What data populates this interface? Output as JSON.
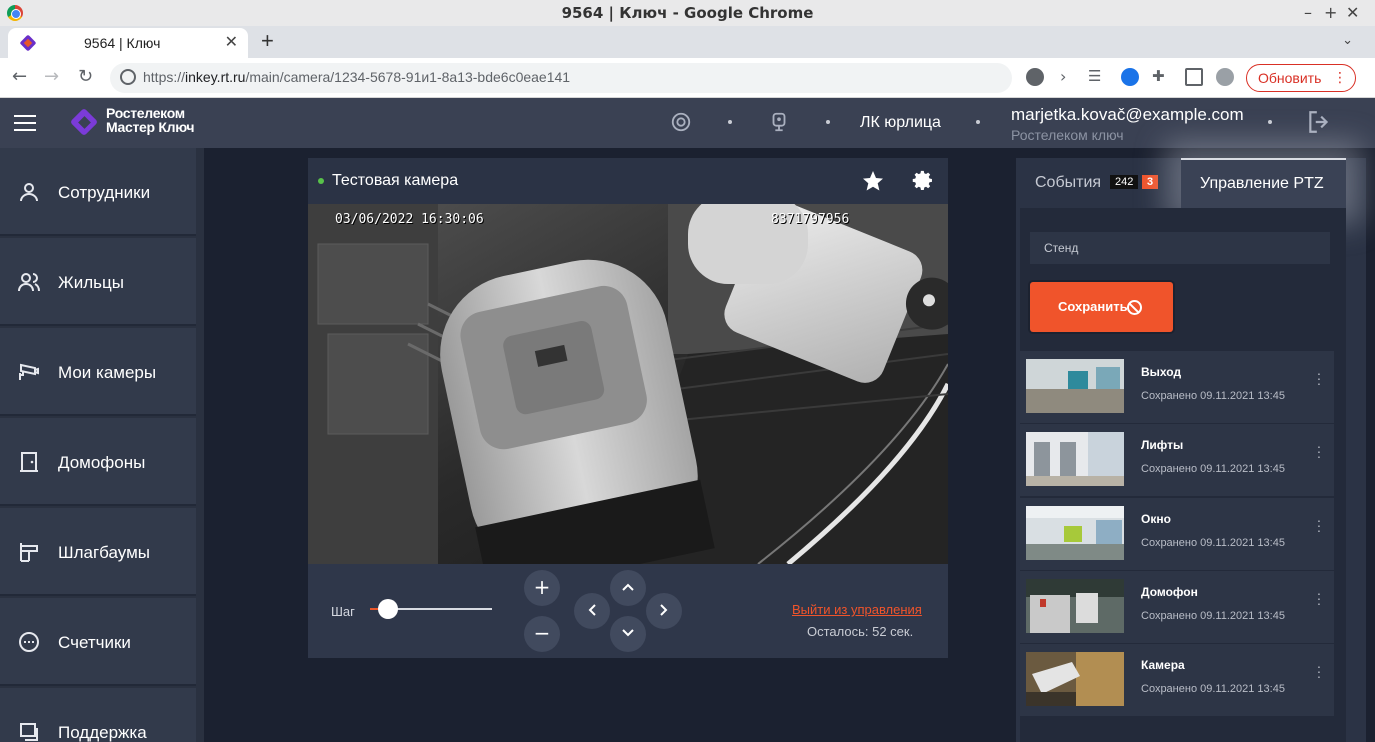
{
  "browser": {
    "window_title": "9564 | Ключ - Google Chrome",
    "tab_title": "9564 | Ключ",
    "url_prefix": "https://",
    "url_host": "inkey.rt.ru",
    "url_path": "/main/camera/1234-5678-91и1-8a13-bde6c0eae141",
    "update_label": "Обновить"
  },
  "header": {
    "logo_line1": "Ростелеком",
    "logo_line2": "Мастер Ключ",
    "account_link": "ЛК юрлица",
    "email": "marjetka.kovač@example.com",
    "company": "Ростелеком ключ"
  },
  "sidebar": {
    "items": [
      {
        "label": "Сотрудники",
        "icon": "person-icon"
      },
      {
        "label": "Жильцы",
        "icon": "people-icon"
      },
      {
        "label": "Мои камеры",
        "icon": "camera-icon"
      },
      {
        "label": "Домофоны",
        "icon": "door-icon"
      },
      {
        "label": "Шлагбаумы",
        "icon": "barrier-icon"
      },
      {
        "label": "Счетчики",
        "icon": "meter-icon"
      },
      {
        "label": "Поддержка",
        "icon": "support-icon"
      }
    ]
  },
  "camera": {
    "title": "Тестовая камера",
    "timestamp": "03/06/2022 16:30:06",
    "serial": "8371797956",
    "step_label": "Шаг",
    "step_value": 0.15,
    "exit_label": "Выйти из управления",
    "remaining": "Осталось: 52 сек."
  },
  "right_panel": {
    "events_label": "События",
    "events_total": "242",
    "events_new": "3",
    "ptz_label": "Управление PTZ",
    "preset_input_value": "Стенд",
    "save_label": "Сохранить",
    "presets": [
      {
        "name": "Выход",
        "date": "Сохранено 09.11.2021 13:45"
      },
      {
        "name": "Лифты",
        "date": "Сохранено 09.11.2021 13:45"
      },
      {
        "name": "Окно",
        "date": "Сохранено 09.11.2021 13:45"
      },
      {
        "name": "Домофон",
        "date": "Сохранено 09.11.2021 13:45"
      },
      {
        "name": "Камера",
        "date": "Сохранено 09.11.2021 13:45"
      }
    ]
  },
  "colors": {
    "accent": "#f0542b",
    "brand": "#7b3bd8",
    "header_bg": "#3a4153",
    "online": "#58c24a"
  }
}
